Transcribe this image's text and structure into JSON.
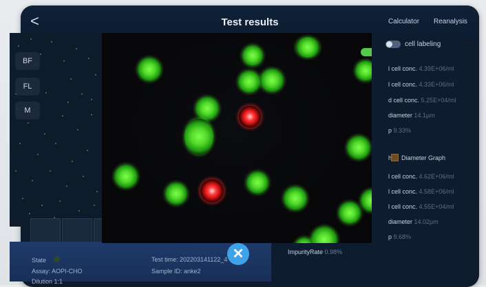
{
  "header": {
    "title": "Test results",
    "back_glyph": "<",
    "buttons": [
      "Calculator",
      "Reanalysis"
    ]
  },
  "left_panel": {
    "modes": [
      "BF",
      "FL",
      "M"
    ]
  },
  "micro": {
    "toggle_state": "on"
  },
  "right_panel": {
    "cell_labeling_label": "cell labeling",
    "rows_top": [
      {
        "label": "l cell conc.",
        "value": "4.39E+06/ml"
      },
      {
        "label": "l cell conc.",
        "value": "4.33E+06/ml"
      },
      {
        "label": "d cell conc.",
        "value": "5.25E+04/ml"
      },
      {
        "label": "diameter",
        "value": "14.1µm"
      },
      {
        "label": "p",
        "value": "9.33%"
      }
    ],
    "graph_prefix": "h",
    "diameter_graph_label": "Diameter Graph",
    "rows_bottom": [
      {
        "label": "l cell conc.",
        "value": "4.62E+06/ml"
      },
      {
        "label": "l cell conc.",
        "value": "4.58E+06/ml"
      },
      {
        "label": "l cell conc.",
        "value": "4.55E+04/ml"
      },
      {
        "label": "diameter",
        "value": "14.02µm"
      },
      {
        "label": "p",
        "value": "9.68%"
      }
    ],
    "impurity_label": "ImpurityRate",
    "impurity_value": "0.98%"
  },
  "info_bar": {
    "state_label": "State",
    "assay": "Assay: AOPI-CHO",
    "dilution": "Dilution 1:1",
    "test_time": "Test time: 202203141122_4",
    "sample_id": "Sample ID: anke2",
    "close_glyph": "✕"
  },
  "colors": {
    "live_cell": "#52d82a",
    "dead_cell": "#d41010",
    "accent": "#3fa3e8"
  }
}
